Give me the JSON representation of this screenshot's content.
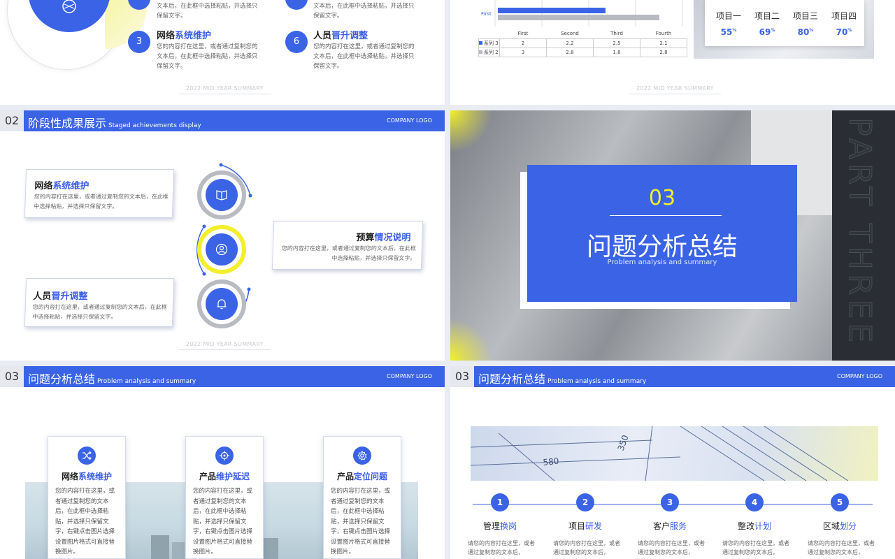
{
  "common": {
    "footer": "2022 MID YEAR SUMMARY",
    "company_logo": "COMPANY LOGO",
    "body_text": "您的内容打在这里，或者通过复制您的文本后，在此框中选择粘贴，并选择只保留文字。",
    "body_text_fragment": "文本后，在此框中选择粘贴，并选择只保留文字。"
  },
  "slide1": {
    "items": [
      {
        "num": "3",
        "title_a": "网络",
        "title_b": "系统维护"
      },
      {
        "num": "6",
        "title_a": "人员",
        "title_b": "晋升调整"
      }
    ]
  },
  "slide2": {
    "chart_data": {
      "type": "bar",
      "orientation": "horizontal",
      "categories": [
        "First",
        "Second",
        "Third",
        "Fourth"
      ],
      "series": [
        {
          "name": "系列 3",
          "values": [
            2,
            2.2,
            2.5,
            2.1
          ],
          "color": "#3a63e6"
        },
        {
          "name": "系列 2",
          "values": [
            3,
            2.8,
            1.8,
            2.8
          ],
          "color": "#b8bbc2"
        }
      ],
      "visible_category_label": "First"
    },
    "table": {
      "headers": [
        "",
        "First",
        "Second",
        "Third",
        "Fourth"
      ],
      "rows": [
        {
          "label": "系列 3",
          "values": [
            "2",
            "2.2",
            "2.5",
            "2.1"
          ]
        },
        {
          "label": "系列 2",
          "values": [
            "3",
            "2.8",
            "1.8",
            "2.8"
          ]
        }
      ]
    },
    "kpis": [
      {
        "name": "项目一",
        "value": "55",
        "unit": "%"
      },
      {
        "name": "项目二",
        "value": "69",
        "unit": "%"
      },
      {
        "name": "项目三",
        "value": "80",
        "unit": "%"
      },
      {
        "name": "项目四",
        "value": "70",
        "unit": "%"
      }
    ]
  },
  "slide3": {
    "num": "02",
    "title": "阶段性成果展示",
    "subtitle": "Staged achievements display",
    "cards": [
      {
        "title_a": "网络",
        "title_b": "系统维护",
        "icon": "book-icon"
      },
      {
        "title_a": "预算",
        "title_b": "情况说明",
        "icon": "user-icon"
      },
      {
        "title_a": "人员",
        "title_b": "晋升调整",
        "icon": "bell-icon"
      }
    ]
  },
  "slide4": {
    "num": "03",
    "title": "问题分析总结",
    "subtitle": "Problem analysis and summary",
    "vertical_text": "PART THREE"
  },
  "slide5": {
    "num": "03",
    "title": "问题分析总结",
    "subtitle": "Problem analysis and summary",
    "cards": [
      {
        "title_a": "网络",
        "title_b": "系统维护",
        "icon": "shuffle-icon"
      },
      {
        "title_a": "产品",
        "title_b": "维护延迟",
        "icon": "target-icon"
      },
      {
        "title_a": "产品",
        "title_b": "定位问题",
        "icon": "gear-icon"
      }
    ],
    "card_text": "您的内容打在这里，或者通过复制您的文本后，在此框中选择粘贴，并选择只保留文字，右键点击图片选择设置图片格式可直接替换图片。"
  },
  "slide6": {
    "num": "03",
    "title": "问题分析总结",
    "subtitle": "Problem analysis and summary",
    "steps": [
      {
        "num": "1",
        "title_a": "管理",
        "title_b": "换岗"
      },
      {
        "num": "2",
        "title_a": "项目",
        "title_b": "研发"
      },
      {
        "num": "3",
        "title_a": "客户",
        "title_b": "服务"
      },
      {
        "num": "4",
        "title_a": "整改",
        "title_b": "计划"
      },
      {
        "num": "5",
        "title_a": "区域",
        "title_b": "划分"
      }
    ],
    "step_text": "请您的内容打在这里，或者通过复制您的文本后，",
    "blueprint_numbers": [
      "580",
      "350"
    ]
  },
  "colors": {
    "accent": "#3a63e6",
    "highlight": "#f3ef2c",
    "gray": "#b8bbc2"
  }
}
